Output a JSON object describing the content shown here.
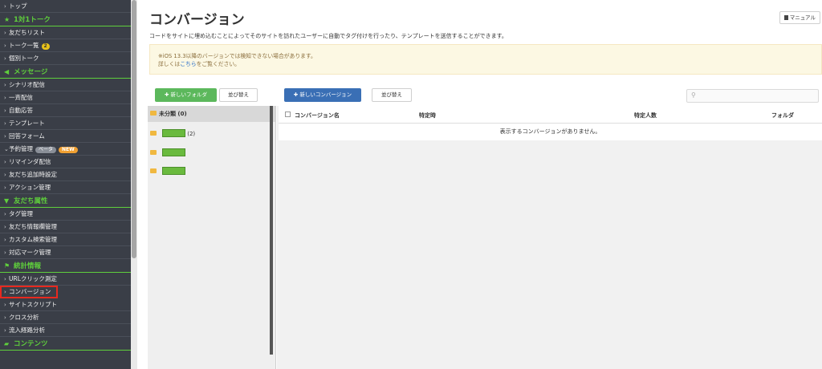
{
  "sidebar": {
    "top_item": "トップ",
    "sec_talk": "1対1トーク",
    "friend_list": "友だちリスト",
    "talk_list": "トーク一覧",
    "talk_count": "2",
    "individual_talk": "個別トーク",
    "sec_message": "メッセージ",
    "scenario": "シナリオ配信",
    "broadcast": "一斉配信",
    "auto_reply": "自動応答",
    "template": "テンプレート",
    "answer_form": "回答フォーム",
    "reservation": "予約管理",
    "beta_badge": "ベータ",
    "new_badge": "NEW",
    "reminder": "リマインダ配信",
    "friend_add": "友だち追加時設定",
    "action": "アクション管理",
    "sec_attr": "友だち属性",
    "tag": "タグ管理",
    "friend_info": "友だち情報欄管理",
    "custom_search": "カスタム検索管理",
    "mark": "対応マーク管理",
    "sec_stats": "統計情報",
    "url_click": "URLクリック測定",
    "conversion": "コンバージョン",
    "site_script": "サイトスクリプト",
    "cross": "クロス分析",
    "inflow": "流入経路分析",
    "sec_content": "コンテンツ"
  },
  "header": {
    "title": "コンバージョン",
    "manual": "マニュアル",
    "description": "コードをサイトに埋め込むことによってそのサイトを訪れたユーザーに自動でタグ付けを行ったり、テンプレートを送信することができます。"
  },
  "notice": {
    "line1": "※iOS 13.3以降のバージョンでは検知できない場合があります。",
    "line2_pre": "詳しくは",
    "line2_link": "こちら",
    "line2_post": "をご覧ください。"
  },
  "toolbar": {
    "new_folder": "新しいフォルダ",
    "sort1": "並び替え",
    "new_conversion": "新しいコンバージョン",
    "sort2": "並び替え"
  },
  "folders": {
    "uncategorized": "未分類 (0)",
    "count": "(2)"
  },
  "table": {
    "col_name": "コンバージョン名",
    "col_time": "特定時",
    "col_people": "特定人数",
    "col_folder": "フォルダ",
    "empty": "表示するコンバージョンがありません。"
  },
  "colors": {
    "sidebar_bg": "#3a3e47",
    "accent_green": "#5fcf3c",
    "button_green": "#5cb85c",
    "button_blue": "#3a6fb5",
    "highlight_red": "#e8291f"
  }
}
